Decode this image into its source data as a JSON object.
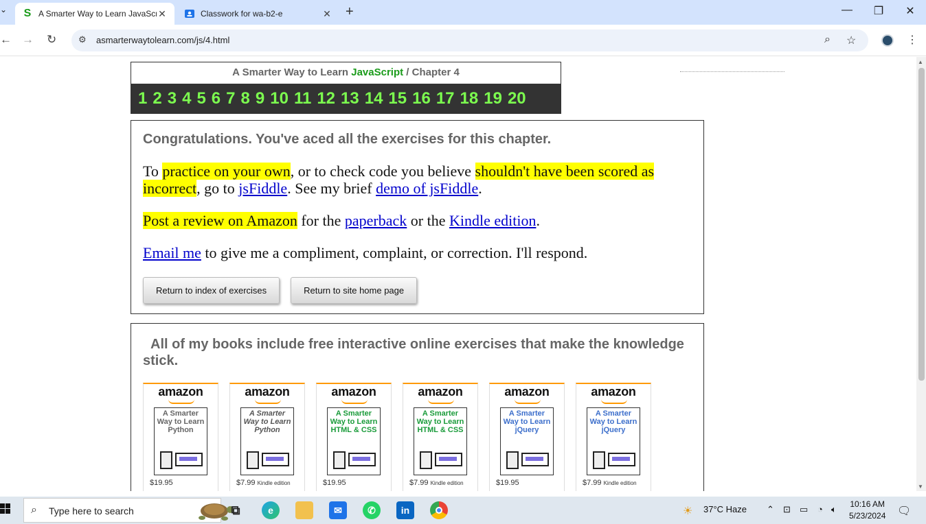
{
  "browser": {
    "tabs": [
      {
        "title": "A Smarter Way to Learn JavaScr",
        "favicon": "S",
        "active": true
      },
      {
        "title": "Classwork for wa-b2-e",
        "favicon": "classroom",
        "active": false
      }
    ],
    "url": "asmarterwaytolearn.com/js/4.html"
  },
  "header": {
    "title_prefix": "A Smarter Way to Learn ",
    "title_js": "JavaScript",
    "title_sep": " / ",
    "title_chapter": "Chapter 4",
    "chapters": [
      "1",
      "2",
      "3",
      "4",
      "5",
      "6",
      "7",
      "8",
      "9",
      "10",
      "11",
      "12",
      "13",
      "14",
      "15",
      "16",
      "17",
      "18",
      "19",
      "20"
    ]
  },
  "congrats": {
    "heading": "Congratulations. You've aced all the exercises for this chapter.",
    "p1_a": "To ",
    "p1_hl1": "practice on your own",
    "p1_b": ", or to check code you believe ",
    "p1_hl2": "shouldn't have been scored as incorrect",
    "p1_c": ", go to ",
    "p1_link1": "jsFiddle",
    "p1_d": ". See my brief ",
    "p1_link2": "demo of jsFiddle",
    "p1_e": ".",
    "p2_hl": "Post a review on Amazon",
    "p2_a": " for the ",
    "p2_link1": "paperback",
    "p2_b": " or the ",
    "p2_link2": "Kindle edition",
    "p2_c": ".",
    "p3_link": "Email me",
    "p3_a": " to give me a compliment, complaint, or correction. I'll respond.",
    "btn_index": "Return to index of exercises",
    "btn_home": "Return to site home page"
  },
  "books_section": {
    "heading": "All of my books include free interactive online exercises that make the knowledge stick.",
    "books": [
      {
        "brand": "amazon",
        "title": "A Smarter Way to Learn Python",
        "price": "$19.95",
        "edition": ""
      },
      {
        "brand": "amazon",
        "title": "A Smarter Way to Learn Python",
        "price": "$7.99",
        "edition": "Kindle edition"
      },
      {
        "brand": "amazon",
        "title": "A Smarter Way to Learn HTML & CSS",
        "price": "$19.95",
        "edition": ""
      },
      {
        "brand": "amazon",
        "title": "A Smarter Way to Learn HTML & CSS",
        "price": "$7.99",
        "edition": "Kindle edition"
      },
      {
        "brand": "amazon",
        "title": "A Smarter Way to Learn jQuery",
        "price": "$19.95",
        "edition": ""
      },
      {
        "brand": "amazon",
        "title": "A Smarter Way to Learn jQuery",
        "price": "$7.99",
        "edition": "Kindle edition"
      }
    ]
  },
  "taskbar": {
    "search_placeholder": "Type here to search",
    "weather": "37°C  Haze",
    "time": "10:16 AM",
    "date": "5/23/2024"
  },
  "colors": {
    "js_green": "#1a9b1a",
    "chapter_green": "#7cfc4f",
    "highlight": "#ffff00",
    "link": "#0000cc",
    "amazon_orange": "#ff9900"
  }
}
